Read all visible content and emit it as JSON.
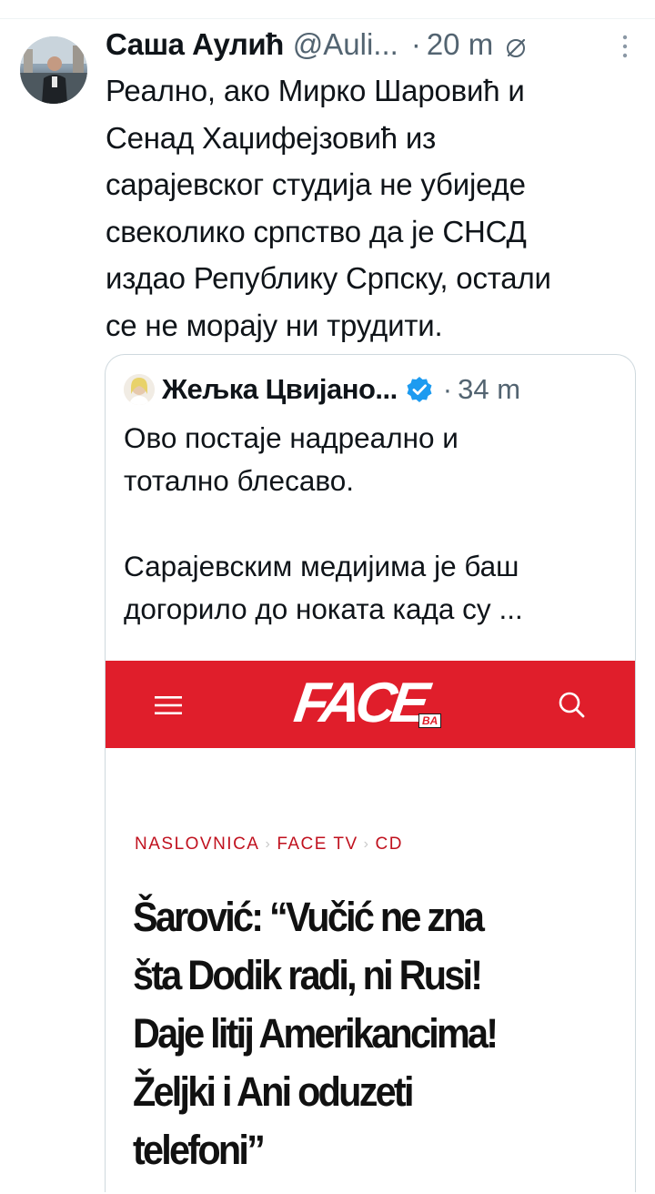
{
  "tweet": {
    "author_name": "Саша Аулић",
    "author_handle": "@Auli...",
    "separator": "·",
    "time": "20 m",
    "text": "Реално, ако Мирко Шаровић и\nСенад Хаџифејзовић из\nсарајевског студија не убиједе\nсвеколико српство да је СНСД\nиздао Републику Српску, остали\nсе не морају ни трудити."
  },
  "quote": {
    "author_name": "Жељка Цвијано...",
    "separator": "·",
    "time": "34 m",
    "text": "Ово постаје надреално и\nтотално блесаво.\n\nСарајевским медијима је баш\nдогорило до ноката када су ..."
  },
  "article": {
    "logo_main": "FACE",
    "logo_sub": "BA",
    "breadcrumb": [
      "NASLOVNICA",
      "FACE TV",
      "CD"
    ],
    "breadcrumb_sep": "›",
    "headline": "Šarović: “Vučić ne zna\nšta Dodik radi, ni Rusi!\nDaje litij Amerikancima!\nŽeljki i Ani oduzeti\ntelefoni”"
  },
  "icons": {
    "edit": "edit-icon",
    "more": "more-icon",
    "verified": "verified-badge-icon",
    "menu": "hamburger-menu-icon",
    "search": "search-icon"
  },
  "colors": {
    "face_red": "#e01e2b",
    "verified_blue": "#1d9bf0",
    "secondary_text": "#536471"
  }
}
